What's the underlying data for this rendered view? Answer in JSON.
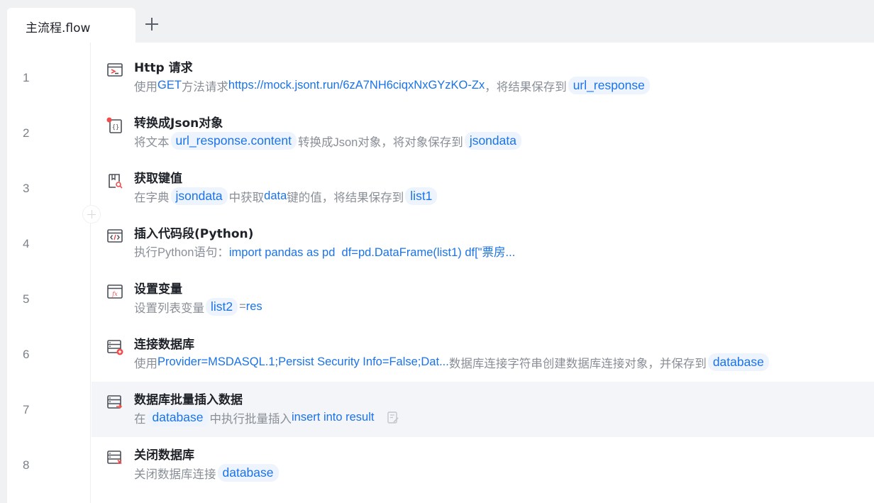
{
  "tabs": [
    {
      "label": "主流程.flow",
      "active": true
    }
  ],
  "line_numbers": [
    "1",
    "2",
    "3",
    "4",
    "5",
    "6",
    "7",
    "8"
  ],
  "colors": {
    "accent": "#1a73e8",
    "chip_bg": "#eef4fd",
    "tabbar_bg": "#f0f1f3",
    "highlight_row": "#f4f5f8",
    "muted_text": "#8a8f97",
    "error_red": "#f24c4c"
  },
  "steps": [
    {
      "icon": "http-request-icon",
      "title": "Http 请求",
      "desc": {
        "t1": "使用",
        "b1": "GET",
        "t2": "方法请求",
        "b2": "https://mock.jsont.run/6zA7NH6ciqxNxGYzKO-Zx",
        "t3": "，将结果保存到",
        "c1": "url_response"
      }
    },
    {
      "icon": "json-convert-icon",
      "title": "转换成Json对象",
      "desc": {
        "t1": "将文本",
        "c1": "url_response.content",
        "t2": "转换成Json对象，将对象保存到",
        "c2": "jsondata"
      }
    },
    {
      "icon": "get-key-value-icon",
      "title": "获取键值",
      "desc": {
        "t1": "在字典",
        "c1": "jsondata",
        "t2": "中获取",
        "b1": "data",
        "t3": "键的值，将结果保存到",
        "c2": "list1"
      }
    },
    {
      "icon": "code-snippet-icon",
      "title": "插入代码段(Python)",
      "desc": {
        "t1": "执行Python语句：",
        "b1": "import pandas as pd  df=pd.DataFrame(list1) df[\"票房..."
      }
    },
    {
      "icon": "set-variable-icon",
      "title": "设置变量",
      "desc": {
        "t1": "设置列表变量",
        "c1": "list2",
        "t2": "=",
        "b1": "res"
      }
    },
    {
      "icon": "db-connect-icon",
      "title": "连接数据库",
      "desc": {
        "t1": "使用",
        "b1": "Provider=MSDASQL.1;Persist Security Info=False;Dat...",
        "t2": "数据库连接字符串创建数据库连接对象，并保存到",
        "c1": "database"
      }
    },
    {
      "icon": "db-batch-insert-icon",
      "title": "数据库批量插入数据",
      "desc": {
        "t1": "在",
        "c1": "database",
        "t2": "中执行批量插入",
        "b1": "insert into result"
      },
      "note_icon": "note-icon"
    },
    {
      "icon": "db-close-icon",
      "title": "关闭数据库",
      "desc": {
        "t1": "关闭数据库连接",
        "c1": "database"
      }
    }
  ]
}
